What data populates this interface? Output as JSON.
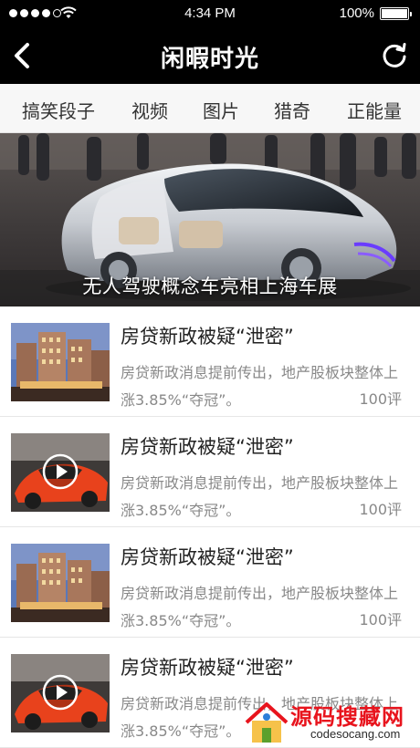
{
  "status_bar": {
    "time": "4:34 PM",
    "battery": "100%",
    "signal_bars_on": 4,
    "signal_bars_total": 5,
    "battery_level": 1.0
  },
  "nav": {
    "title": "闲暇时光",
    "back_icon": "chevron-left-icon",
    "refresh_icon": "refresh-icon"
  },
  "tabs": [
    {
      "label": "搞笑段子"
    },
    {
      "label": "视频"
    },
    {
      "label": "图片"
    },
    {
      "label": "猎奇"
    },
    {
      "label": "正能量"
    }
  ],
  "hero": {
    "caption": "无人驾驶概念车亮相上海车展"
  },
  "news": [
    {
      "title": "房贷新政被疑“泄密”",
      "summary": "房贷新政消息提前传出，地产股板块整体上涨3.85%“夺冠”。",
      "comments": "100评",
      "thumb": "building",
      "video": false
    },
    {
      "title": "房贷新政被疑“泄密”",
      "summary": "房贷新政消息提前传出，地产股板块整体上涨3.85%“夺冠”。",
      "comments": "100评",
      "thumb": "car",
      "video": true
    },
    {
      "title": "房贷新政被疑“泄密”",
      "summary": "房贷新政消息提前传出，地产股板块整体上涨3.85%“夺冠”。",
      "comments": "100评",
      "thumb": "building",
      "video": false
    },
    {
      "title": "房贷新政被疑“泄密”",
      "summary": "房贷新政消息提前传出，地产股板块整体上涨3.85%“夺冠”。",
      "comments": "",
      "thumb": "car",
      "video": true
    }
  ],
  "watermark": {
    "text": "源码搜藏网",
    "url": "codesocang.com"
  },
  "colors": {
    "bar_bg": "#000000",
    "tabs_bg": "#f7f7f7",
    "watermark_red": "#e8141d"
  }
}
